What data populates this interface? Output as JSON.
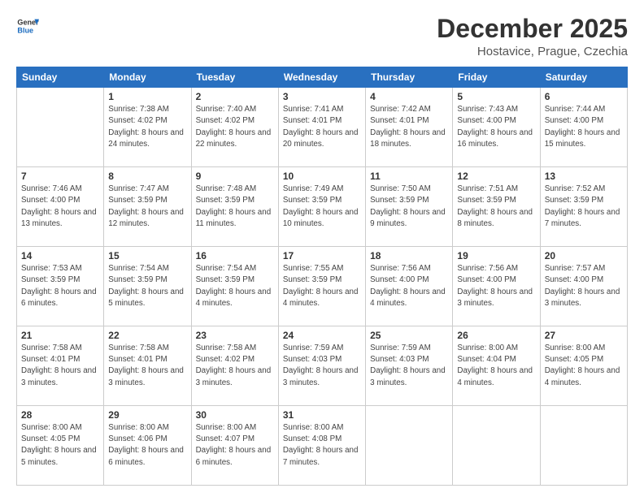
{
  "header": {
    "logo": {
      "line1": "General",
      "line2": "Blue"
    },
    "title": "December 2025",
    "subtitle": "Hostavice, Prague, Czechia"
  },
  "calendar": {
    "days_of_week": [
      "Sunday",
      "Monday",
      "Tuesday",
      "Wednesday",
      "Thursday",
      "Friday",
      "Saturday"
    ],
    "weeks": [
      [
        {
          "day": "",
          "sunrise": "",
          "sunset": "",
          "daylight": ""
        },
        {
          "day": "1",
          "sunrise": "Sunrise: 7:38 AM",
          "sunset": "Sunset: 4:02 PM",
          "daylight": "Daylight: 8 hours and 24 minutes."
        },
        {
          "day": "2",
          "sunrise": "Sunrise: 7:40 AM",
          "sunset": "Sunset: 4:02 PM",
          "daylight": "Daylight: 8 hours and 22 minutes."
        },
        {
          "day": "3",
          "sunrise": "Sunrise: 7:41 AM",
          "sunset": "Sunset: 4:01 PM",
          "daylight": "Daylight: 8 hours and 20 minutes."
        },
        {
          "day": "4",
          "sunrise": "Sunrise: 7:42 AM",
          "sunset": "Sunset: 4:01 PM",
          "daylight": "Daylight: 8 hours and 18 minutes."
        },
        {
          "day": "5",
          "sunrise": "Sunrise: 7:43 AM",
          "sunset": "Sunset: 4:00 PM",
          "daylight": "Daylight: 8 hours and 16 minutes."
        },
        {
          "day": "6",
          "sunrise": "Sunrise: 7:44 AM",
          "sunset": "Sunset: 4:00 PM",
          "daylight": "Daylight: 8 hours and 15 minutes."
        }
      ],
      [
        {
          "day": "7",
          "sunrise": "Sunrise: 7:46 AM",
          "sunset": "Sunset: 4:00 PM",
          "daylight": "Daylight: 8 hours and 13 minutes."
        },
        {
          "day": "8",
          "sunrise": "Sunrise: 7:47 AM",
          "sunset": "Sunset: 3:59 PM",
          "daylight": "Daylight: 8 hours and 12 minutes."
        },
        {
          "day": "9",
          "sunrise": "Sunrise: 7:48 AM",
          "sunset": "Sunset: 3:59 PM",
          "daylight": "Daylight: 8 hours and 11 minutes."
        },
        {
          "day": "10",
          "sunrise": "Sunrise: 7:49 AM",
          "sunset": "Sunset: 3:59 PM",
          "daylight": "Daylight: 8 hours and 10 minutes."
        },
        {
          "day": "11",
          "sunrise": "Sunrise: 7:50 AM",
          "sunset": "Sunset: 3:59 PM",
          "daylight": "Daylight: 8 hours and 9 minutes."
        },
        {
          "day": "12",
          "sunrise": "Sunrise: 7:51 AM",
          "sunset": "Sunset: 3:59 PM",
          "daylight": "Daylight: 8 hours and 8 minutes."
        },
        {
          "day": "13",
          "sunrise": "Sunrise: 7:52 AM",
          "sunset": "Sunset: 3:59 PM",
          "daylight": "Daylight: 8 hours and 7 minutes."
        }
      ],
      [
        {
          "day": "14",
          "sunrise": "Sunrise: 7:53 AM",
          "sunset": "Sunset: 3:59 PM",
          "daylight": "Daylight: 8 hours and 6 minutes."
        },
        {
          "day": "15",
          "sunrise": "Sunrise: 7:54 AM",
          "sunset": "Sunset: 3:59 PM",
          "daylight": "Daylight: 8 hours and 5 minutes."
        },
        {
          "day": "16",
          "sunrise": "Sunrise: 7:54 AM",
          "sunset": "Sunset: 3:59 PM",
          "daylight": "Daylight: 8 hours and 4 minutes."
        },
        {
          "day": "17",
          "sunrise": "Sunrise: 7:55 AM",
          "sunset": "Sunset: 3:59 PM",
          "daylight": "Daylight: 8 hours and 4 minutes."
        },
        {
          "day": "18",
          "sunrise": "Sunrise: 7:56 AM",
          "sunset": "Sunset: 4:00 PM",
          "daylight": "Daylight: 8 hours and 4 minutes."
        },
        {
          "day": "19",
          "sunrise": "Sunrise: 7:56 AM",
          "sunset": "Sunset: 4:00 PM",
          "daylight": "Daylight: 8 hours and 3 minutes."
        },
        {
          "day": "20",
          "sunrise": "Sunrise: 7:57 AM",
          "sunset": "Sunset: 4:00 PM",
          "daylight": "Daylight: 8 hours and 3 minutes."
        }
      ],
      [
        {
          "day": "21",
          "sunrise": "Sunrise: 7:58 AM",
          "sunset": "Sunset: 4:01 PM",
          "daylight": "Daylight: 8 hours and 3 minutes."
        },
        {
          "day": "22",
          "sunrise": "Sunrise: 7:58 AM",
          "sunset": "Sunset: 4:01 PM",
          "daylight": "Daylight: 8 hours and 3 minutes."
        },
        {
          "day": "23",
          "sunrise": "Sunrise: 7:58 AM",
          "sunset": "Sunset: 4:02 PM",
          "daylight": "Daylight: 8 hours and 3 minutes."
        },
        {
          "day": "24",
          "sunrise": "Sunrise: 7:59 AM",
          "sunset": "Sunset: 4:03 PM",
          "daylight": "Daylight: 8 hours and 3 minutes."
        },
        {
          "day": "25",
          "sunrise": "Sunrise: 7:59 AM",
          "sunset": "Sunset: 4:03 PM",
          "daylight": "Daylight: 8 hours and 3 minutes."
        },
        {
          "day": "26",
          "sunrise": "Sunrise: 8:00 AM",
          "sunset": "Sunset: 4:04 PM",
          "daylight": "Daylight: 8 hours and 4 minutes."
        },
        {
          "day": "27",
          "sunrise": "Sunrise: 8:00 AM",
          "sunset": "Sunset: 4:05 PM",
          "daylight": "Daylight: 8 hours and 4 minutes."
        }
      ],
      [
        {
          "day": "28",
          "sunrise": "Sunrise: 8:00 AM",
          "sunset": "Sunset: 4:05 PM",
          "daylight": "Daylight: 8 hours and 5 minutes."
        },
        {
          "day": "29",
          "sunrise": "Sunrise: 8:00 AM",
          "sunset": "Sunset: 4:06 PM",
          "daylight": "Daylight: 8 hours and 6 minutes."
        },
        {
          "day": "30",
          "sunrise": "Sunrise: 8:00 AM",
          "sunset": "Sunset: 4:07 PM",
          "daylight": "Daylight: 8 hours and 6 minutes."
        },
        {
          "day": "31",
          "sunrise": "Sunrise: 8:00 AM",
          "sunset": "Sunset: 4:08 PM",
          "daylight": "Daylight: 8 hours and 7 minutes."
        },
        {
          "day": "",
          "sunrise": "",
          "sunset": "",
          "daylight": ""
        },
        {
          "day": "",
          "sunrise": "",
          "sunset": "",
          "daylight": ""
        },
        {
          "day": "",
          "sunrise": "",
          "sunset": "",
          "daylight": ""
        }
      ]
    ]
  }
}
